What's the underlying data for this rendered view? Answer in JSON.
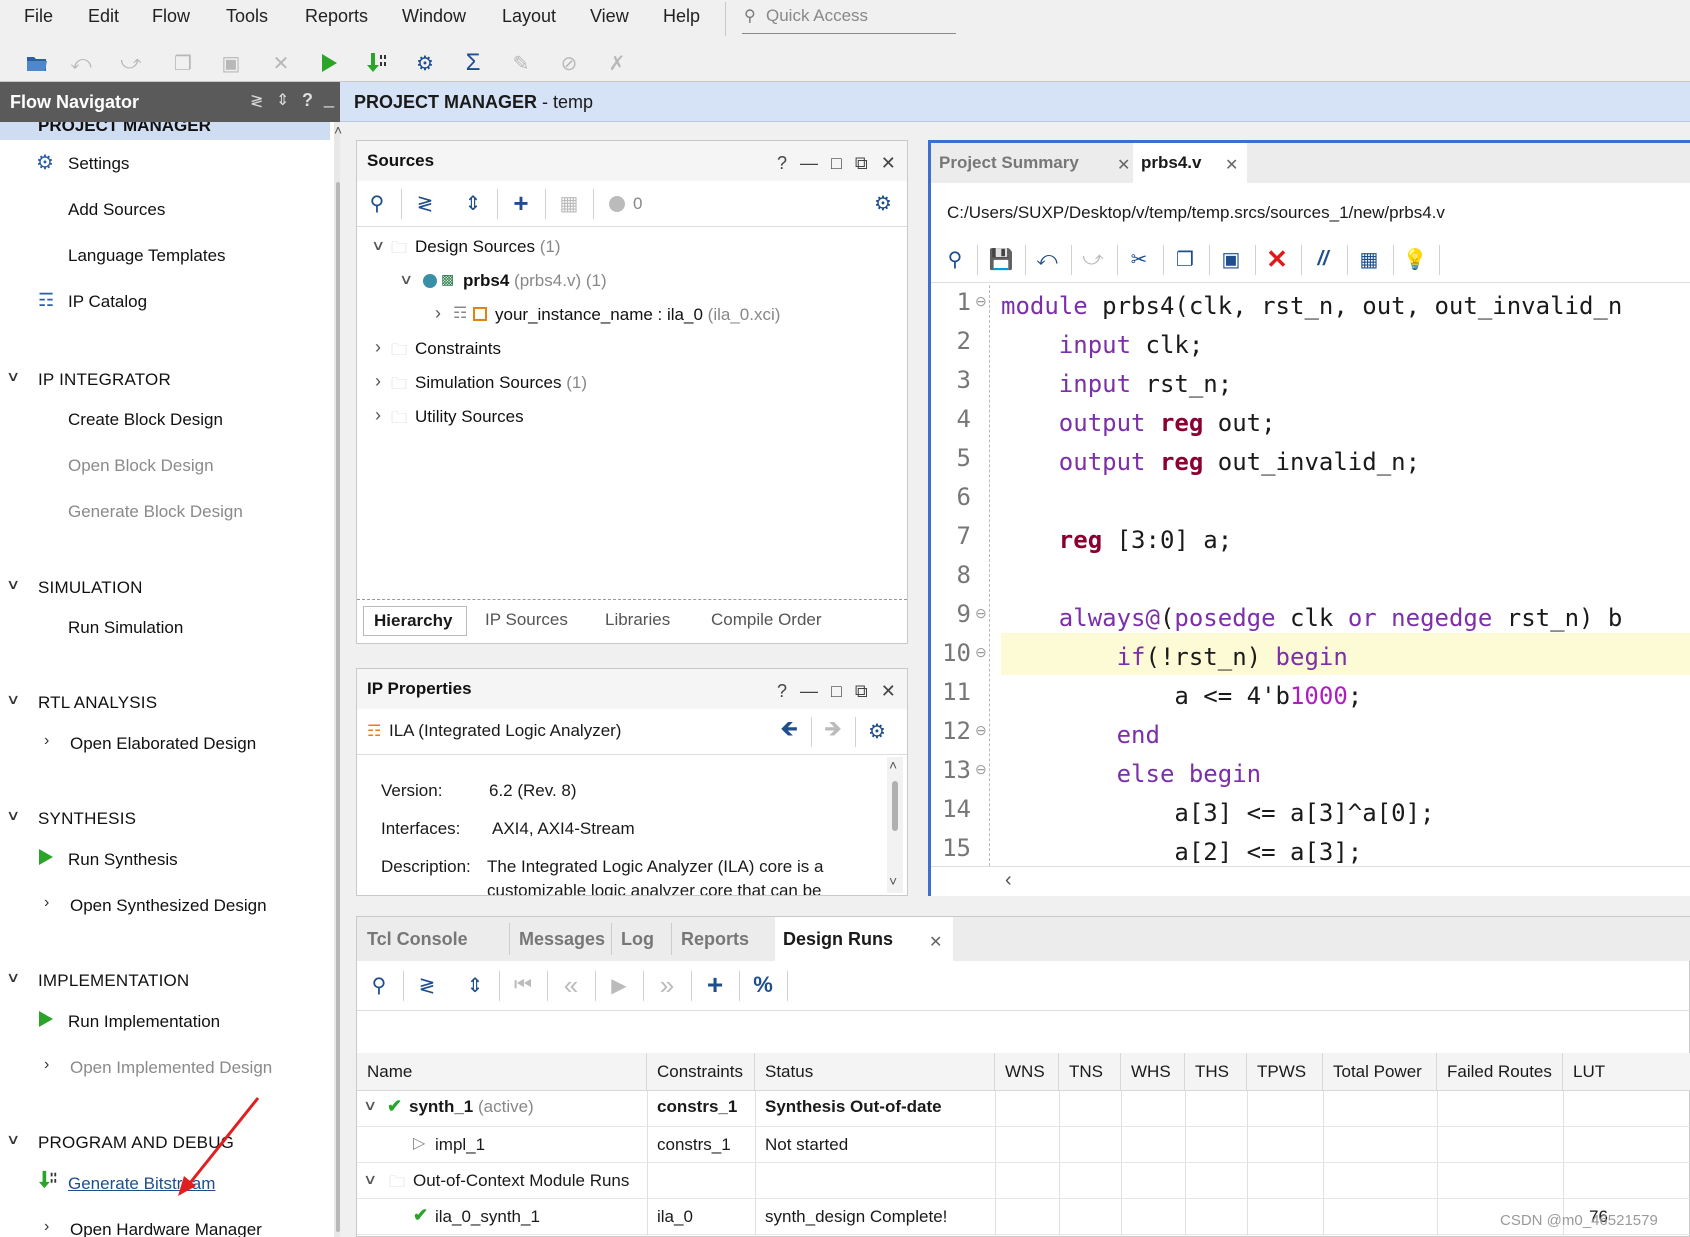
{
  "menu": {
    "file": "File",
    "edit": "Edit",
    "flow": "Flow",
    "tools": "Tools",
    "reports": "Reports",
    "window": "Window",
    "layout": "Layout",
    "view": "View",
    "help": "Help",
    "quick_access_placeholder": "Quick Access"
  },
  "toolbar_icons": [
    "open-project-icon",
    "undo-icon",
    "redo-icon",
    "copy-icon",
    "paste-icon",
    "delete-icon",
    "run-icon",
    "program-device-icon",
    "settings-icon",
    "sigma-icon",
    "compile-icon",
    "disabled-icon",
    "disabled-x-icon"
  ],
  "flow_navigator": {
    "title": "Flow Navigator",
    "project_manager": "PROJECT MANAGER",
    "settings": "Settings",
    "add_sources": "Add Sources",
    "language_templates": "Language Templates",
    "ip_catalog": "IP Catalog",
    "ip_integrator": "IP INTEGRATOR",
    "create_block_design": "Create Block Design",
    "open_block_design": "Open Block Design",
    "generate_block_design": "Generate Block Design",
    "simulation": "SIMULATION",
    "run_simulation": "Run Simulation",
    "rtl_analysis": "RTL ANALYSIS",
    "open_elaborated_design": "Open Elaborated Design",
    "synthesis": "SYNTHESIS",
    "run_synthesis": "Run Synthesis",
    "open_synthesized_design": "Open Synthesized Design",
    "implementation": "IMPLEMENTATION",
    "run_implementation": "Run Implementation",
    "open_implemented_design": "Open Implemented Design",
    "program_and_debug": "PROGRAM AND DEBUG",
    "generate_bitstream": "Generate Bitstream",
    "open_hardware_manager": "Open Hardware Manager"
  },
  "header": {
    "title_bold": "PROJECT MANAGER",
    "title_rest": " - temp"
  },
  "sources": {
    "title": "Sources",
    "error_count": "0",
    "design_sources": "Design Sources",
    "design_sources_count": "(1)",
    "top_module": "prbs4",
    "top_module_file": "(prbs4.v) (1)",
    "instance": "your_instance_name : ila_0",
    "instance_file": "(ila_0.xci)",
    "constraints": "Constraints",
    "simulation_sources": "Simulation Sources",
    "simulation_sources_count": "(1)",
    "utility_sources": "Utility Sources",
    "tabs": [
      "Hierarchy",
      "IP Sources",
      "Libraries",
      "Compile Order"
    ]
  },
  "ip_properties": {
    "title": "IP Properties",
    "ip_name": "ILA (Integrated Logic Analyzer)",
    "version_label": "Version:",
    "version_value": "6.2 (Rev. 8)",
    "interfaces_label": "Interfaces:",
    "interfaces_value": "AXI4, AXI4-Stream",
    "description_label": "Description:",
    "description_line1": "The Integrated Logic Analyzer (ILA) core is a",
    "description_line2": "customizable logic analyzer core that can be"
  },
  "editor": {
    "tab_summary": "Project Summary",
    "tab_file": "prbs4.v",
    "path": "C:/Users/SUXP/Desktop/v/temp/temp.srcs/sources_1/new/prbs4.v",
    "line_numbers": [
      "1",
      "2",
      "3",
      "4",
      "5",
      "6",
      "7",
      "8",
      "9",
      "10",
      "11",
      "12",
      "13",
      "14",
      "15"
    ]
  },
  "bottom": {
    "tabs": [
      "Tcl Console",
      "Messages",
      "Log",
      "Reports",
      "Design Runs"
    ],
    "columns": [
      "Name",
      "Constraints",
      "Status",
      "WNS",
      "TNS",
      "WHS",
      "THS",
      "TPWS",
      "Total Power",
      "Failed Routes",
      "LUT"
    ],
    "rows": [
      {
        "name": "synth_1",
        "suffix": "(active)",
        "constraints": "constrs_1",
        "status": "Synthesis Out-of-date"
      },
      {
        "name": "impl_1",
        "suffix": "",
        "constraints": "constrs_1",
        "status": "Not started"
      },
      {
        "name": "Out-of-Context Module Runs",
        "suffix": "",
        "constraints": "",
        "status": ""
      },
      {
        "name": "ila_0_synth_1",
        "suffix": "",
        "constraints": "ila_0",
        "status": "synth_design Complete!",
        "lut": "76"
      }
    ]
  },
  "watermark": "CSDN @m0_46521579",
  "colors": {
    "header_bg": "#d6e3f7",
    "nav_title_bg": "#5a5a5a",
    "editor_border": "#3b6fd1",
    "highlight_line": "#fdfbd6",
    "run_green": "#2aa52a",
    "error_red": "#e01b1b",
    "annotation_arrow": "#e02020"
  }
}
